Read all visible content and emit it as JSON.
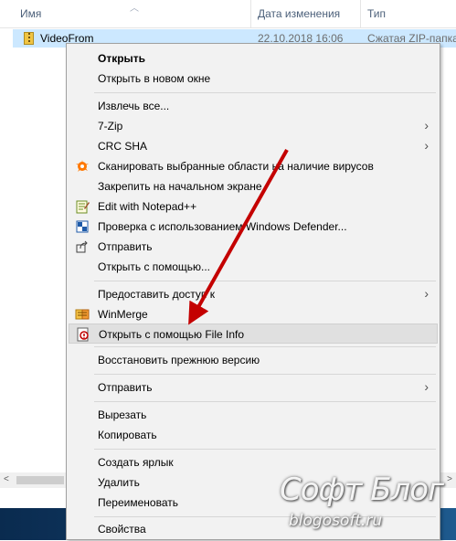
{
  "columns": {
    "name": "Имя",
    "date": "Дата изменения",
    "type": "Тип"
  },
  "file": {
    "name": "VideoFrom",
    "date": "22.10.2018 16:06",
    "type": "Сжатая ZIP-папка"
  },
  "menu": {
    "items": [
      {
        "label": "Открыть"
      },
      {
        "label": "Открыть в новом окне"
      },
      {
        "label": "Извлечь все..."
      },
      {
        "label": "7-Zip"
      },
      {
        "label": "CRC SHA"
      },
      {
        "label": "Сканировать выбранные области на наличие вирусов"
      },
      {
        "label": "Закрепить на начальном экране"
      },
      {
        "label": "Edit with Notepad++"
      },
      {
        "label": "Проверка с использованием Windows Defender..."
      },
      {
        "label": "Отправить"
      },
      {
        "label": "Открыть с помощью..."
      },
      {
        "label": "Предоставить доступ к"
      },
      {
        "label": "WinMerge"
      },
      {
        "label": "Открыть с помощью File Info"
      },
      {
        "label": "Восстановить прежнюю версию"
      },
      {
        "label": "Отправить"
      },
      {
        "label": "Вырезать"
      },
      {
        "label": "Копировать"
      },
      {
        "label": "Создать ярлык"
      },
      {
        "label": "Удалить"
      },
      {
        "label": "Переименовать"
      },
      {
        "label": "Свойства"
      }
    ]
  },
  "watermark": {
    "title": "Софт Блог",
    "site": "blogosoft.ru"
  },
  "colors": {
    "selection": "#cce8ff",
    "menu_bg": "#f2f2f2",
    "hover": "#e0e0e0",
    "arrow": "#c40000"
  }
}
